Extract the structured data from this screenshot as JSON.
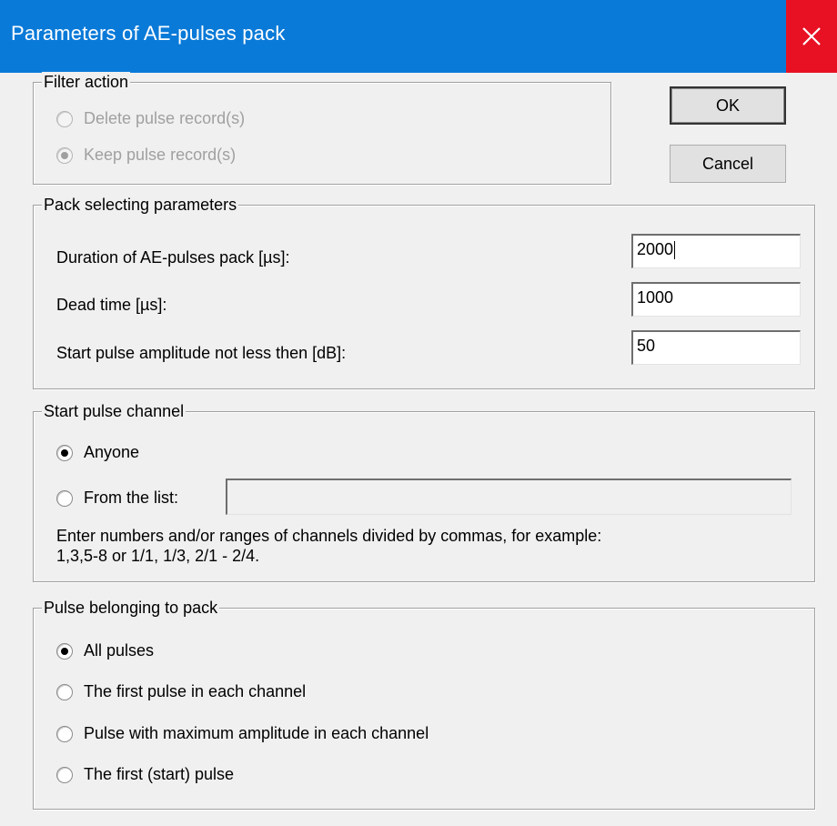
{
  "window": {
    "title": "Parameters of AE-pulses pack"
  },
  "buttons": {
    "ok_label": "OK",
    "cancel_label": "Cancel"
  },
  "filter_action": {
    "legend": "Filter action",
    "options": [
      {
        "label": "Delete pulse record(s)",
        "checked": false,
        "enabled": false
      },
      {
        "label": "Keep pulse record(s)",
        "checked": true,
        "enabled": false
      }
    ]
  },
  "pack_params": {
    "legend": "Pack selecting parameters",
    "fields": [
      {
        "label": "Duration of AE-pulses pack [µs]:",
        "value": "2000"
      },
      {
        "label": "Dead time [µs]:",
        "value": "1000"
      },
      {
        "label": "Start pulse amplitude not less then [dB]:",
        "value": "50"
      }
    ]
  },
  "start_channel": {
    "legend": "Start pulse channel",
    "options": [
      {
        "label": "Anyone",
        "checked": true
      },
      {
        "label": "From the list:",
        "checked": false
      }
    ],
    "list_value": "",
    "hint_line1": "Enter numbers and/or ranges of channels divided by commas, for example:",
    "hint_line2": "1,3,5-8 or 1/1, 1/3, 2/1 - 2/4."
  },
  "pulse_belonging": {
    "legend": "Pulse belonging to pack",
    "options": [
      {
        "label": "All pulses",
        "checked": true
      },
      {
        "label": "The first pulse in each channel",
        "checked": false
      },
      {
        "label": "Pulse with maximum amplitude in each channel",
        "checked": false
      },
      {
        "label": "The first (start) pulse",
        "checked": false
      }
    ]
  }
}
